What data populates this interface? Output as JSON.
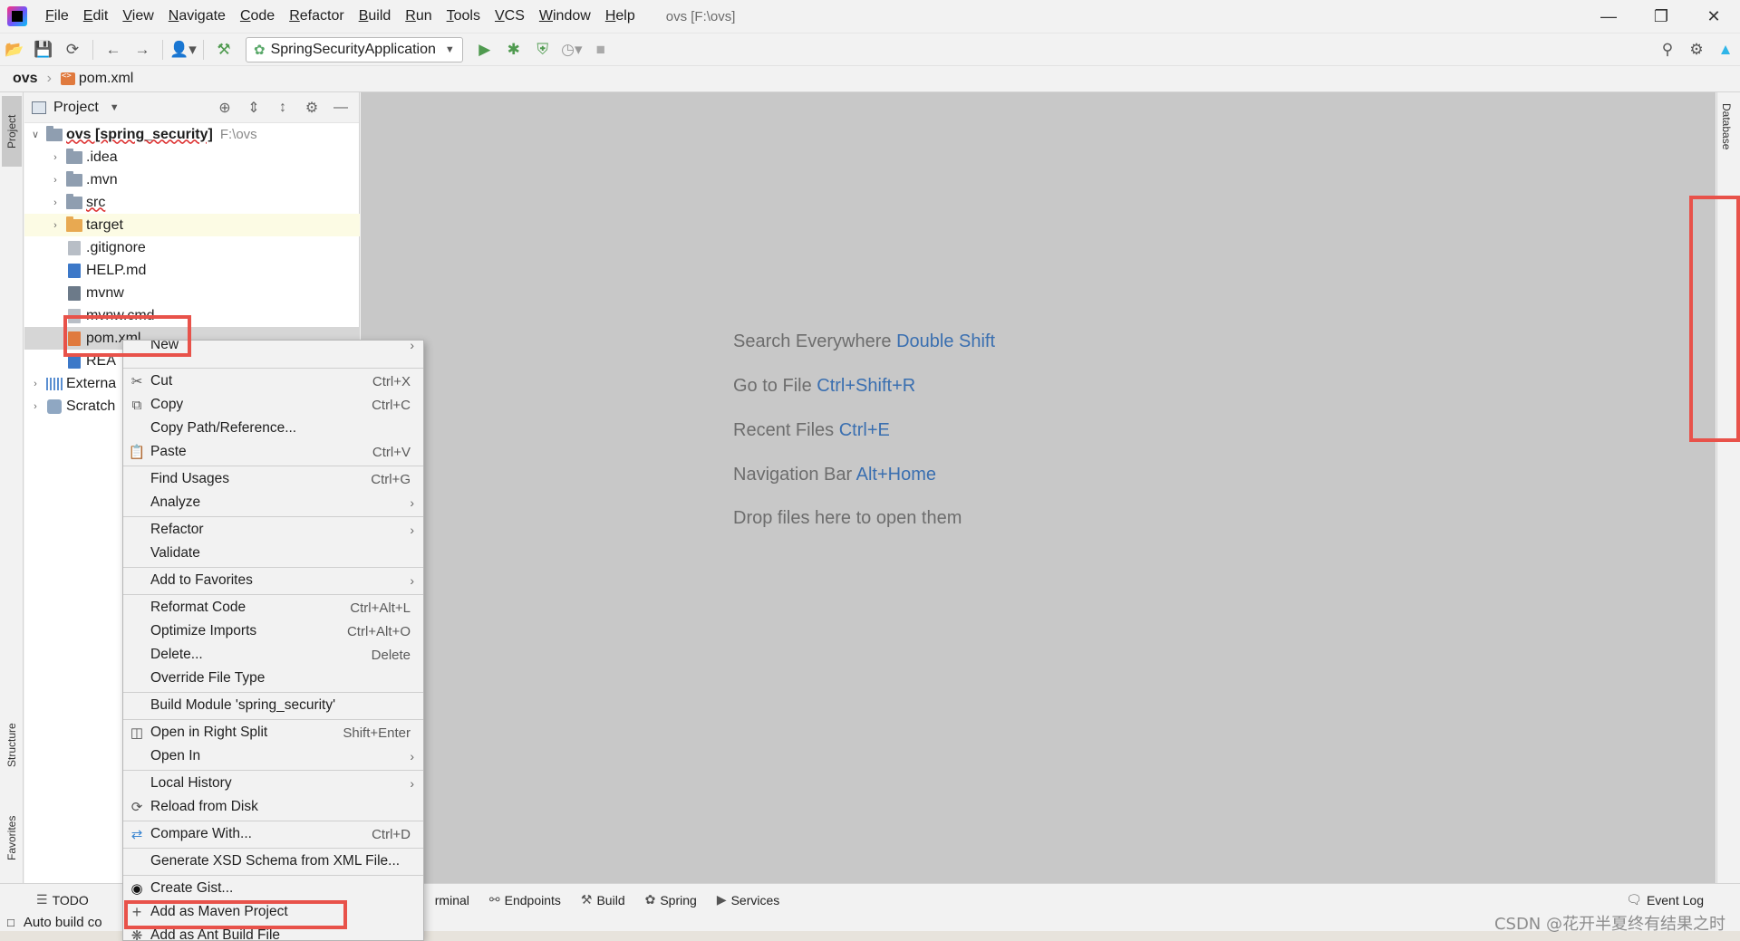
{
  "menubar": {
    "items": [
      "File",
      "Edit",
      "View",
      "Navigate",
      "Code",
      "Refactor",
      "Build",
      "Run",
      "Tools",
      "VCS",
      "Window",
      "Help"
    ],
    "window_title": "ovs [F:\\ovs]"
  },
  "toolbar": {
    "run_config": "SpringSecurityApplication"
  },
  "breadcrumb": {
    "root": "ovs",
    "file": "pom.xml"
  },
  "stripes": {
    "project": "Project",
    "structure": "Structure",
    "favorites": "Favorites",
    "database": "Database"
  },
  "project_panel": {
    "title": "Project",
    "tree": [
      {
        "label": "ovs [spring_security]",
        "path": "F:\\ovs",
        "kind": "root"
      },
      {
        "label": ".idea",
        "kind": "folder"
      },
      {
        "label": ".mvn",
        "kind": "folder"
      },
      {
        "label": "src",
        "kind": "folder"
      },
      {
        "label": "target",
        "kind": "folder-orange"
      },
      {
        "label": ".gitignore",
        "kind": "file"
      },
      {
        "label": "HELP.md",
        "kind": "md"
      },
      {
        "label": "mvnw",
        "kind": "sh"
      },
      {
        "label": "mvnw.cmd",
        "kind": "file"
      },
      {
        "label": "pom.xml",
        "kind": "xml"
      },
      {
        "label": "REA",
        "kind": "md"
      },
      {
        "label": "Externa",
        "kind": "lib"
      },
      {
        "label": "Scratch",
        "kind": "scratch"
      }
    ]
  },
  "editor_hints": [
    {
      "text": "Search Everywhere",
      "key": "Double Shift"
    },
    {
      "text": "Go to File",
      "key": "Ctrl+Shift+R"
    },
    {
      "text": "Recent Files",
      "key": "Ctrl+E"
    },
    {
      "text": "Navigation Bar",
      "key": "Alt+Home"
    },
    {
      "text": "Drop files here to open them",
      "key": ""
    }
  ],
  "context_menu": {
    "items": [
      {
        "label": "New",
        "shortcut": "",
        "submenu": true,
        "icon": ""
      },
      {
        "label": "Cut",
        "shortcut": "Ctrl+X",
        "submenu": false,
        "icon": "scissors-icon"
      },
      {
        "label": "Copy",
        "shortcut": "Ctrl+C",
        "submenu": false,
        "icon": "copy-icon"
      },
      {
        "label": "Copy Path/Reference...",
        "shortcut": "",
        "submenu": false,
        "icon": ""
      },
      {
        "label": "Paste",
        "shortcut": "Ctrl+V",
        "submenu": false,
        "icon": "paste-icon"
      },
      {
        "label": "Find Usages",
        "shortcut": "Ctrl+G",
        "submenu": false,
        "icon": ""
      },
      {
        "label": "Analyze",
        "shortcut": "",
        "submenu": true,
        "icon": ""
      },
      {
        "label": "Refactor",
        "shortcut": "",
        "submenu": true,
        "icon": ""
      },
      {
        "label": "Validate",
        "shortcut": "",
        "submenu": false,
        "icon": ""
      },
      {
        "label": "Add to Favorites",
        "shortcut": "",
        "submenu": true,
        "icon": ""
      },
      {
        "label": "Reformat Code",
        "shortcut": "Ctrl+Alt+L",
        "submenu": false,
        "icon": ""
      },
      {
        "label": "Optimize Imports",
        "shortcut": "Ctrl+Alt+O",
        "submenu": false,
        "icon": ""
      },
      {
        "label": "Delete...",
        "shortcut": "Delete",
        "submenu": false,
        "icon": ""
      },
      {
        "label": "Override File Type",
        "shortcut": "",
        "submenu": false,
        "icon": ""
      },
      {
        "label": "Build Module 'spring_security'",
        "shortcut": "",
        "submenu": false,
        "icon": ""
      },
      {
        "label": "Open in Right Split",
        "shortcut": "Shift+Enter",
        "submenu": false,
        "icon": "split-icon"
      },
      {
        "label": "Open In",
        "shortcut": "",
        "submenu": true,
        "icon": ""
      },
      {
        "label": "Local History",
        "shortcut": "",
        "submenu": true,
        "icon": ""
      },
      {
        "label": "Reload from Disk",
        "shortcut": "",
        "submenu": false,
        "icon": "reload-icon"
      },
      {
        "label": "Compare With...",
        "shortcut": "Ctrl+D",
        "submenu": false,
        "icon": "compare-icon"
      },
      {
        "label": "Generate XSD Schema from XML File...",
        "shortcut": "",
        "submenu": false,
        "icon": ""
      },
      {
        "label": "Create Gist...",
        "shortcut": "",
        "submenu": false,
        "icon": "github-icon"
      },
      {
        "label": "Add as Maven Project",
        "shortcut": "",
        "submenu": false,
        "icon": "plus-icon"
      },
      {
        "label": "Add as Ant Build File",
        "shortcut": "",
        "submenu": false,
        "icon": "ant-icon"
      }
    ]
  },
  "bottom_tabs": {
    "todo": "TODO",
    "terminal": "rminal",
    "endpoints": "Endpoints",
    "build": "Build",
    "spring": "Spring",
    "services": "Services",
    "event_log": "Event Log"
  },
  "status": {
    "text": "Auto build co"
  },
  "watermark": "CSDN @花开半夏终有结果之时",
  "colors": {
    "highlight_red": "#e8524a",
    "shortcut_blue": "#3a6fb0",
    "editor_bg": "#c8c8c8"
  }
}
